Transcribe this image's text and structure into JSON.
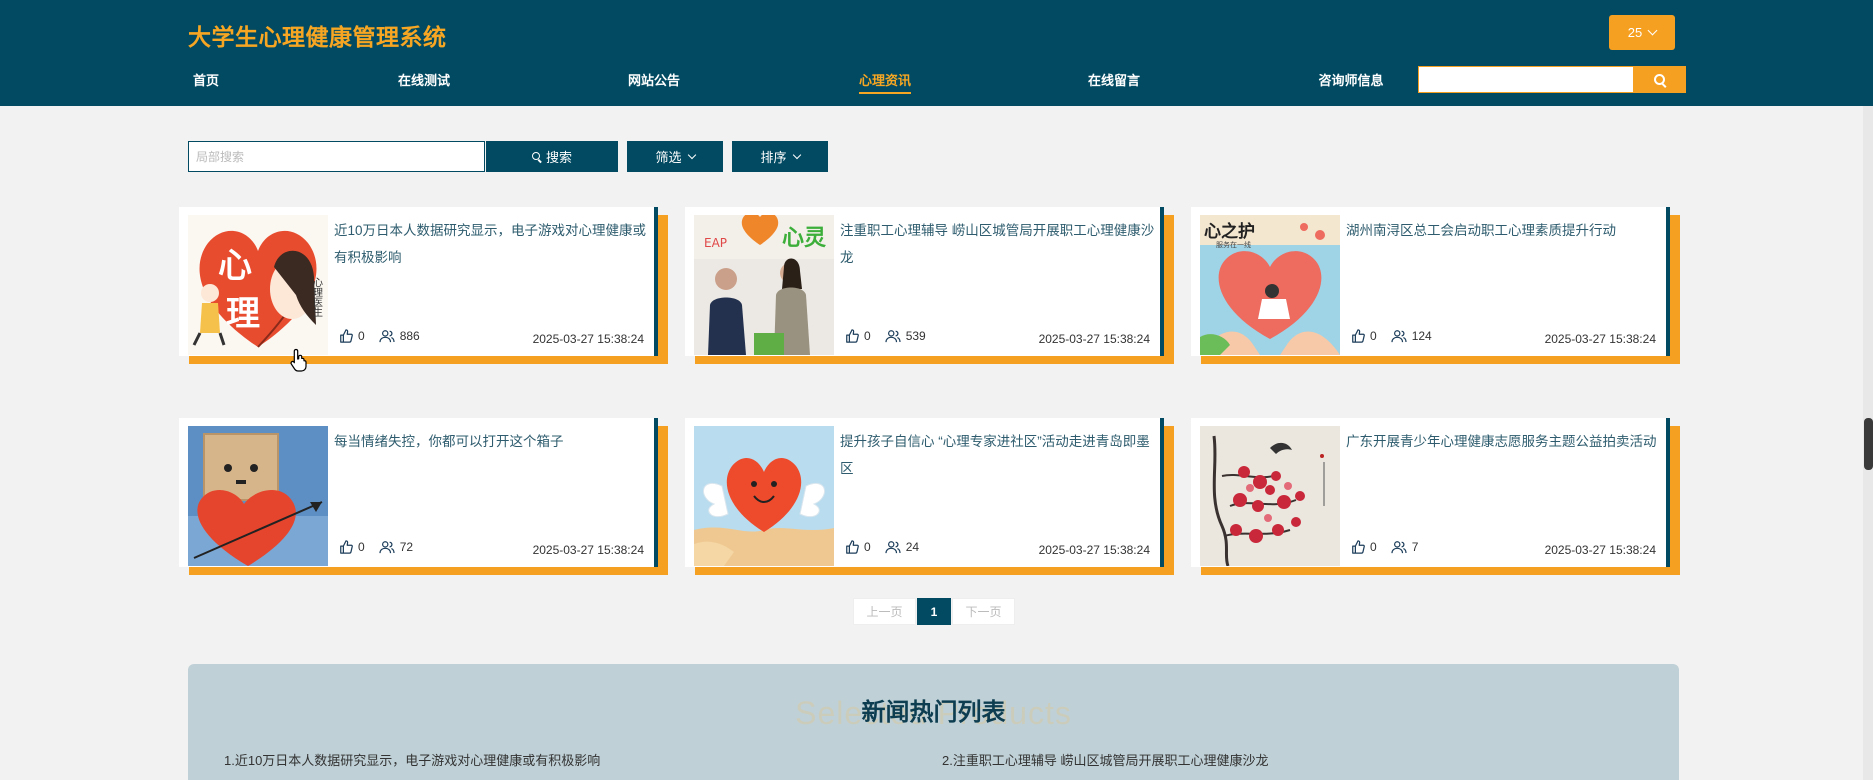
{
  "header": {
    "brand": "大学生心理健康管理系统",
    "user_label": "25",
    "search": {
      "value": "",
      "placeholder": ""
    }
  },
  "nav": [
    {
      "label": "首页",
      "active": false
    },
    {
      "label": "在线测试",
      "active": false
    },
    {
      "label": "网站公告",
      "active": false
    },
    {
      "label": "心理资讯",
      "active": true
    },
    {
      "label": "在线留言",
      "active": false
    },
    {
      "label": "咨询师信息",
      "active": false
    }
  ],
  "toolbar": {
    "search_placeholder": "局部搜索",
    "search_button": "搜索",
    "filter_label": "筛选",
    "sort_label": "排序"
  },
  "articles": [
    {
      "title": "近10万日本人数据研究显示，电子游戏对心理健康或有积极影响",
      "likes": "0",
      "views": "886",
      "date": "2025-03-27 15:38:24",
      "image": "心理 heart illustration"
    },
    {
      "title": "注重职工心理辅导 崂山区城管局开展职工心理健康沙龙",
      "likes": "0",
      "views": "539",
      "date": "2025-03-27 15:38:24",
      "image": "心灵 salon photo"
    },
    {
      "title": "湖州南浔区总工会启动职工心理素质提升行动",
      "likes": "0",
      "views": "124",
      "date": "2025-03-27 15:38:24",
      "image": "心之护 heart hands"
    },
    {
      "title": "每当情绪失控，你都可以打开这个箱子",
      "likes": "0",
      "views": "72",
      "date": "2025-03-27 15:38:24",
      "image": "box robot heart"
    },
    {
      "title": "提升孩子自信心 “心理专家进社区”活动走进青岛即墨区",
      "likes": "0",
      "views": "24",
      "date": "2025-03-27 15:38:24",
      "image": "winged heart"
    },
    {
      "title": "广东开展青少年心理健康志愿服务主题公益拍卖活动",
      "likes": "0",
      "views": "7",
      "date": "2025-03-27 15:38:24",
      "image": "plum blossom painting"
    }
  ],
  "card_image_text": {
    "xin": "心",
    "li": "理",
    "doctor": "心理医生",
    "xinling": "心灵",
    "ap": "EAP",
    "xinzhihu": "心之护",
    "sub": "服务在一线"
  },
  "pagination": {
    "prev": "上一页",
    "current": "1",
    "next": "下一页"
  },
  "hot": {
    "watermark": "Selected Products",
    "title": "新闻热门列表",
    "items": [
      "1.近10万日本人数据研究显示，电子游戏对心理健康或有积极影响",
      "2.注重职工心理辅导 崂山区城管局开展职工心理健康沙龙"
    ]
  },
  "colors": {
    "primary": "#014a62",
    "accent": "#f6a021",
    "panel": "#bfd0d6"
  },
  "icons": {
    "search": "search-icon",
    "like": "thumbs-up-icon",
    "views": "users-icon",
    "dropdown": "chevron-down-icon"
  }
}
